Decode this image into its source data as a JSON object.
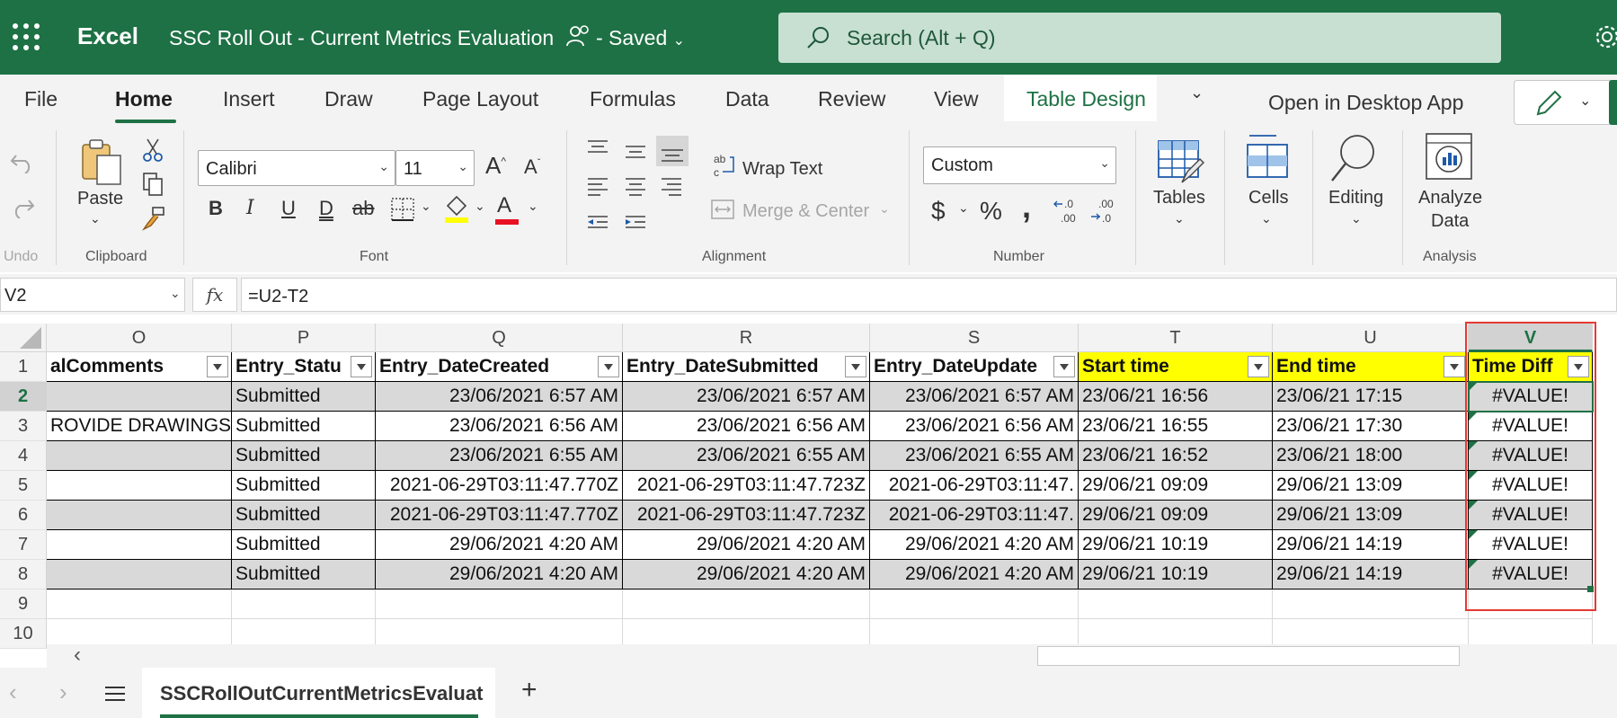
{
  "app": {
    "name": "Excel",
    "doc_title": "SSC Roll Out - Current Metrics Evaluation",
    "save_state": "- Saved"
  },
  "search": {
    "placeholder": "Search (Alt + Q)"
  },
  "tabs": [
    "File",
    "Home",
    "Insert",
    "Draw",
    "Page Layout",
    "Formulas",
    "Data",
    "Review",
    "View",
    "Table Design"
  ],
  "active_tab": "Home",
  "open_desktop": "Open in Desktop App",
  "ribbon": {
    "undo_label": "Undo",
    "clipboard": {
      "paste": "Paste",
      "group": "Clipboard"
    },
    "font": {
      "family": "Calibri",
      "size": "11",
      "group": "Font",
      "bold": "B",
      "italic": "I",
      "underline": "U",
      "double_underline": "D",
      "strikethrough": "ab",
      "font_color_letter": "A"
    },
    "alignment": {
      "wrap": "Wrap Text",
      "merge": "Merge & Center",
      "group": "Alignment"
    },
    "number": {
      "format": "Custom",
      "currency": "$",
      "percent": "%",
      "comma": ",",
      "group": "Number"
    },
    "tables": "Tables",
    "cells": "Cells",
    "editing": "Editing",
    "analyze": [
      "Analyze",
      "Data"
    ],
    "analysis_group": "Analysis"
  },
  "formula_bar": {
    "name_box": "V2",
    "fx": "fx",
    "formula": "=U2-T2"
  },
  "columns": [
    "O",
    "P",
    "Q",
    "R",
    "S",
    "T",
    "U",
    "V"
  ],
  "selected_column": "V",
  "rows": [
    "1",
    "2",
    "3",
    "4",
    "5",
    "6",
    "7",
    "8",
    "9",
    "10"
  ],
  "selected_row": "2",
  "headers": [
    "alComments",
    "Entry_Statu",
    "Entry_DateCreated",
    "Entry_DateSubmitted",
    "Entry_DateUpdate",
    "Start time",
    "End time",
    "Time Diff"
  ],
  "table_rows": [
    [
      "",
      "Submitted",
      "23/06/2021 6:57 AM",
      "23/06/2021 6:57 AM",
      "23/06/2021 6:57 AM",
      "23/06/21 16:56",
      "23/06/21 17:15",
      "#VALUE!"
    ],
    [
      "ROVIDE DRAWINGS",
      "Submitted",
      "23/06/2021 6:56 AM",
      "23/06/2021 6:56 AM",
      "23/06/2021 6:56 AM",
      "23/06/21 16:55",
      "23/06/21 17:30",
      "#VALUE!"
    ],
    [
      "",
      "Submitted",
      "23/06/2021 6:55 AM",
      "23/06/2021 6:55 AM",
      "23/06/2021 6:55 AM",
      "23/06/21 16:52",
      "23/06/21 18:00",
      "#VALUE!"
    ],
    [
      "",
      "Submitted",
      "2021-06-29T03:11:47.770Z",
      "2021-06-29T03:11:47.723Z",
      "2021-06-29T03:11:47.",
      "29/06/21 09:09",
      "29/06/21 13:09",
      "#VALUE!"
    ],
    [
      "",
      "Submitted",
      "2021-06-29T03:11:47.770Z",
      "2021-06-29T03:11:47.723Z",
      "2021-06-29T03:11:47.",
      "29/06/21 09:09",
      "29/06/21 13:09",
      "#VALUE!"
    ],
    [
      "",
      "Submitted",
      "29/06/2021 4:20 AM",
      "29/06/2021 4:20 AM",
      "29/06/2021 4:20 AM",
      "29/06/21 10:19",
      "29/06/21 14:19",
      "#VALUE!"
    ],
    [
      "",
      "Submitted",
      "29/06/2021 4:20 AM",
      "29/06/2021 4:20 AM",
      "29/06/2021 4:20 AM",
      "29/06/21 10:19",
      "29/06/21 14:19",
      "#VALUE!"
    ]
  ],
  "sheet": {
    "name": "SSCRollOutCurrentMetricsEvaluat",
    "add": "+"
  },
  "colors": {
    "brand": "#1e7145",
    "highlight": "#ffff00",
    "band": "#d9d9d9",
    "callout": "#e53935"
  }
}
